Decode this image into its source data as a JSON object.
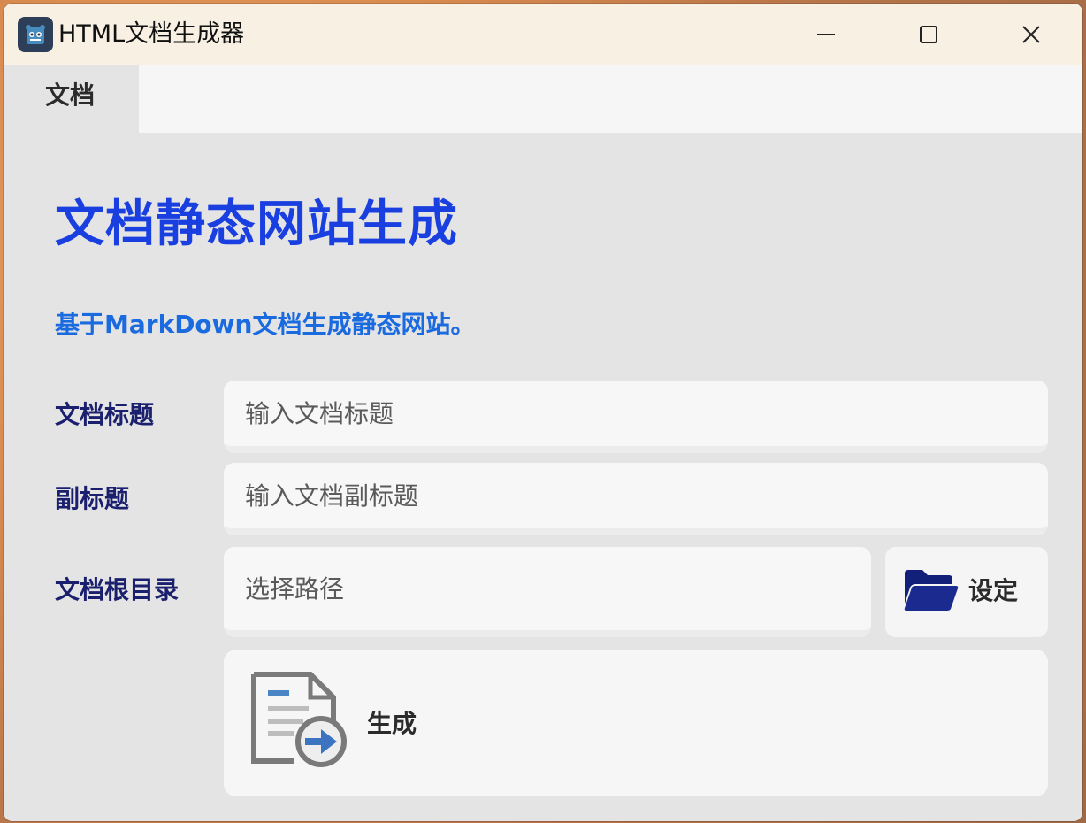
{
  "window": {
    "title": "HTML文档生成器",
    "icon": "godot-app-icon",
    "controls": [
      "minimize-icon",
      "maximize-icon",
      "close-icon"
    ]
  },
  "tabs": [
    {
      "label": "文档",
      "active": true
    }
  ],
  "main": {
    "heading": "文档静态网站生成",
    "subheading": "基于MarkDown文档生成静态网站。",
    "fields": {
      "title": {
        "label": "文档标题",
        "value": "",
        "placeholder": "输入文档标题"
      },
      "subtitle": {
        "label": "副标题",
        "value": "",
        "placeholder": "输入文档副标题"
      },
      "root": {
        "label": "文档根目录",
        "value": "",
        "placeholder": "选择路径"
      }
    },
    "set_button": {
      "label": "设定",
      "icon": "folder-icon"
    },
    "generate_button": {
      "label": "生成",
      "icon": "document-export-icon"
    }
  },
  "colors": {
    "heading": "#1a3fe0",
    "subheading": "#1a6ae0",
    "label": "#1a1f6e",
    "folder": "#12207a"
  }
}
